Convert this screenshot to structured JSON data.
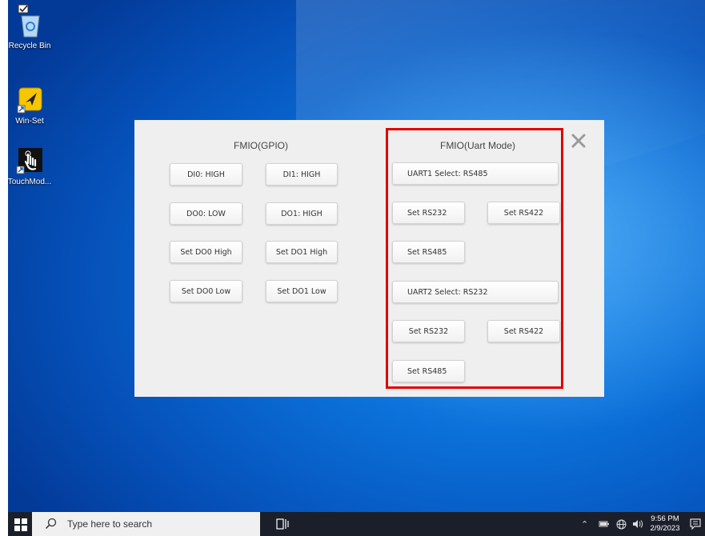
{
  "desktop": {
    "icons": [
      {
        "label": "Recycle Bin",
        "icon": "recycle-bin-icon"
      },
      {
        "label": "Win-Set",
        "icon": "win-set-icon"
      },
      {
        "label": "TouchMod...",
        "icon": "touch-mode-icon"
      }
    ]
  },
  "dialog": {
    "gpio": {
      "title": "FMIO(GPIO)",
      "di0": "DI0: HIGH",
      "di1": "DI1: HIGH",
      "do0": "DO0: LOW",
      "do1": "DO1: HIGH",
      "set_do0_high": "Set DO0 High",
      "set_do1_high": "Set DO1 High",
      "set_do0_low": "Set DO0 Low",
      "set_do1_low": "Set DO1 Low"
    },
    "uart": {
      "title": "FMIO(Uart Mode)",
      "uart1_select": "UART1 Select: RS485",
      "uart1_rs232": "Set RS232",
      "uart1_rs422": "Set RS422",
      "uart1_rs485": "Set RS485",
      "uart2_select": "UART2 Select: RS232",
      "uart2_rs232": "Set RS232",
      "uart2_rs422": "Set RS422",
      "uart2_rs485": "Set RS485"
    },
    "close_icon": "close-icon",
    "highlight_color": "#e00000"
  },
  "taskbar": {
    "search_placeholder": "Type here to search",
    "time": "9:56 PM",
    "date": "2/9/2023"
  }
}
